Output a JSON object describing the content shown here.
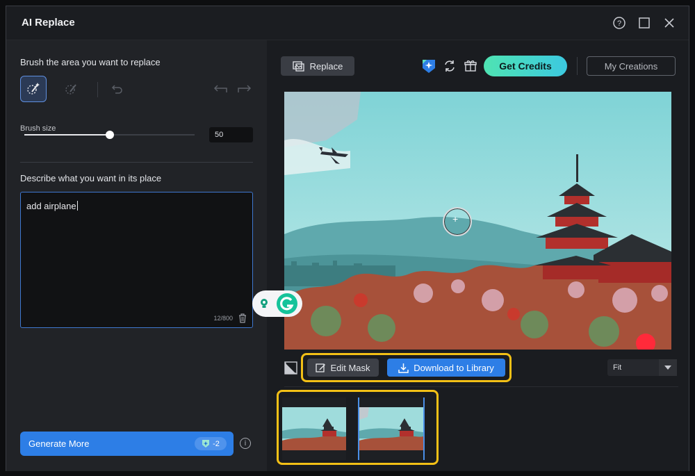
{
  "window": {
    "title": "AI Replace"
  },
  "left": {
    "brush_heading": "Brush the area you want to replace",
    "brush_size_label": "Brush size",
    "brush_size_value": "50",
    "brush_size_level": 0.5,
    "describe_heading": "Describe what you want in its place",
    "prompt_text": "add airplane",
    "char_counter": "12/800",
    "generate_label": "Generate More",
    "generate_cost": "-2"
  },
  "right": {
    "replace_label": "Replace",
    "get_credits_label": "Get Credits",
    "my_creations_label": "My Creations",
    "edit_mask_label": "Edit Mask",
    "download_label": "Download to Library",
    "zoom_select": "Fit"
  },
  "colors": {
    "accent": "#2d7ee6",
    "highlight": "#f3c016",
    "credits_gradient_start": "#4fe3b2",
    "credits_gradient_end": "#3cc9e0"
  }
}
